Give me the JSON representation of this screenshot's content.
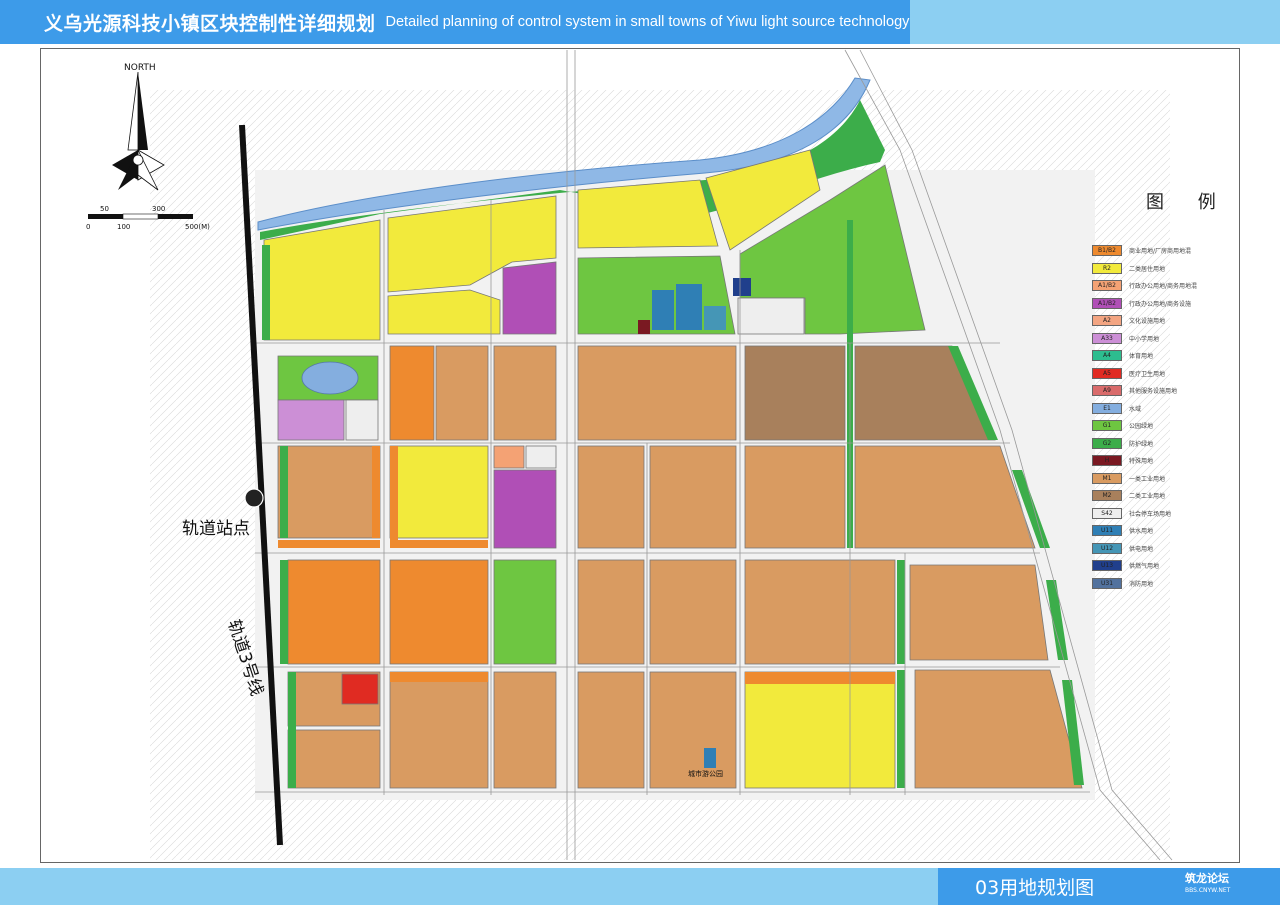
{
  "header": {
    "title_cn": "义乌光源科技小镇区块控制性详细规划",
    "title_en": "Detailed planning of control system in small towns of Yiwu light source technology"
  },
  "compass": {
    "label": "NORTH"
  },
  "scale_bar": {
    "ticks_top": [
      "50",
      "300"
    ],
    "ticks_bottom": [
      "0",
      "100",
      "500(M)"
    ]
  },
  "map_labels": {
    "station": "轨道站点",
    "rail_line": "轨道3号线",
    "park": "城市游公园"
  },
  "legend": {
    "title": "图  例",
    "items": [
      {
        "code": "B1/B2",
        "color": "#ee8a2f",
        "label": "商业用地/厂房商用地混"
      },
      {
        "code": "R2",
        "color": "#f2ea3c",
        "label": "二类居住用地"
      },
      {
        "code": "A1/B2",
        "color": "#f4a274",
        "label": "行政办公用地/商务用地混"
      },
      {
        "code": "A1/B2",
        "color": "#b04fb6",
        "label": "行政办公用地/商务设施"
      },
      {
        "code": "A2",
        "color": "#f3a582",
        "label": "文化设施用地"
      },
      {
        "code": "A33",
        "color": "#cc8fd6",
        "label": "中小学用地"
      },
      {
        "code": "A4",
        "color": "#2dbd8f",
        "label": "体育用地"
      },
      {
        "code": "A5",
        "color": "#e02b22",
        "label": "医疗卫生用地"
      },
      {
        "code": "A9",
        "color": "#d96b6b",
        "label": "其他服务设施用地"
      },
      {
        "code": "E1",
        "color": "#84aedf",
        "label": "水域"
      },
      {
        "code": "G1",
        "color": "#6ec641",
        "label": "公园绿地"
      },
      {
        "code": "G2",
        "color": "#3cad4a",
        "label": "防护绿地"
      },
      {
        "code": "H",
        "color": "#7a1922",
        "label": "特殊用地"
      },
      {
        "code": "M1",
        "color": "#d99b61",
        "label": "一类工业用地"
      },
      {
        "code": "M2",
        "color": "#a8805c",
        "label": "二类工业用地"
      },
      {
        "code": "S42",
        "color": "#eeeeee",
        "label": "社会停车场用地"
      },
      {
        "code": "U11",
        "color": "#2f7fb5",
        "label": "供水用地"
      },
      {
        "code": "U12",
        "color": "#4596b6",
        "label": "供电用地"
      },
      {
        "code": "U13",
        "color": "#203f8c",
        "label": "供燃气用地"
      },
      {
        "code": "U31",
        "color": "#52729e",
        "label": "消防用地"
      }
    ]
  },
  "footer": {
    "title": "03用地规划图"
  },
  "watermark": {
    "main": "筑龙论坛",
    "sub": "BBS.CNYW.NET"
  }
}
